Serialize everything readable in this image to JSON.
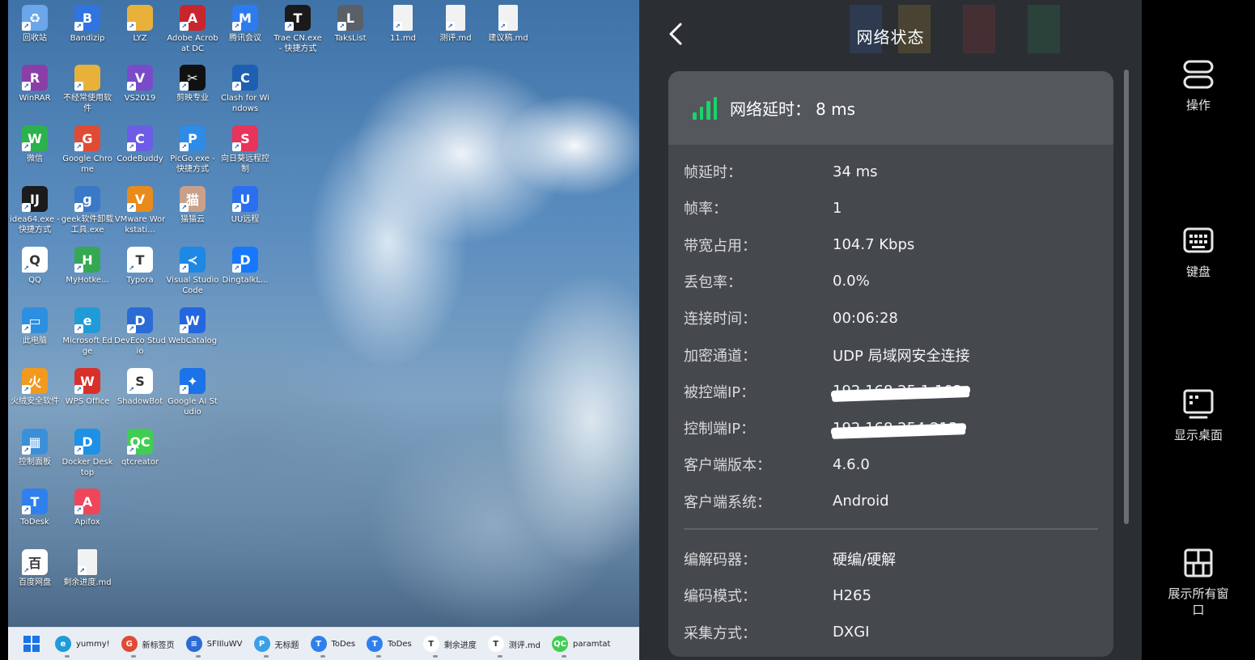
{
  "desktop": {
    "icons": [
      {
        "label": "回收站",
        "icon": "recycle-bin-icon",
        "color": "#6aa6e8",
        "glyph": "♻"
      },
      {
        "label": "Bandizip",
        "icon": "bandizip-icon",
        "color": "#2f74e0",
        "glyph": "B"
      },
      {
        "label": "LYZ",
        "icon": "folder-icon",
        "color": "#e8b23a",
        "glyph": ""
      },
      {
        "label": "Adobe Acrobat DC",
        "icon": "acrobat-icon",
        "color": "#c8262c",
        "glyph": "A"
      },
      {
        "label": "腾讯会议",
        "icon": "tencent-meeting-icon",
        "color": "#2d7bf0",
        "glyph": "M"
      },
      {
        "label": "Trae CN.exe - 快捷方式",
        "icon": "trae-icon",
        "color": "#1a1a1a",
        "glyph": "T"
      },
      {
        "label": "TaksList",
        "icon": "tasklist-icon",
        "color": "#5a6068",
        "glyph": "L"
      },
      {
        "label": "11.md",
        "icon": "md-file-icon",
        "color": "#f2f2f2",
        "glyph": ""
      },
      {
        "label": "测评.md",
        "icon": "md-file-icon",
        "color": "#f2f2f2",
        "glyph": ""
      },
      {
        "label": "建议稿.md",
        "icon": "md-file-icon",
        "color": "#f2f2f2",
        "glyph": ""
      },
      {
        "label": "WinRAR",
        "icon": "winrar-icon",
        "color": "#8a3ea8",
        "glyph": "R"
      },
      {
        "label": "不经常使用软件",
        "icon": "folder-icon",
        "color": "#e8b23a",
        "glyph": ""
      },
      {
        "label": "VS2019",
        "icon": "visual-studio-icon",
        "color": "#7a4bc8",
        "glyph": "V"
      },
      {
        "label": "剪映专业",
        "icon": "capcut-icon",
        "color": "#111111",
        "glyph": "✂"
      },
      {
        "label": "Clash for Windows",
        "icon": "clash-icon",
        "color": "#1d5fb0",
        "glyph": "C"
      },
      {
        "label": "微信",
        "icon": "wechat-icon",
        "color": "#2bb24c",
        "glyph": "W"
      },
      {
        "label": "Google Chrome",
        "icon": "chrome-icon",
        "color": "#e04b35",
        "glyph": "G"
      },
      {
        "label": "CodeBuddy",
        "icon": "codebuddy-icon",
        "color": "#6c5ce7",
        "glyph": "C"
      },
      {
        "label": "PicGo.exe - 快捷方式",
        "icon": "picgo-icon",
        "color": "#2e8be6",
        "glyph": "P"
      },
      {
        "label": "向日葵远程控制",
        "icon": "sunlogin-icon",
        "color": "#e8335a",
        "glyph": "S"
      },
      {
        "label": "idea64.exe - 快捷方式",
        "icon": "intellij-icon",
        "color": "#1b1b1b",
        "glyph": "IJ"
      },
      {
        "label": "geek软件卸载工具.exe",
        "icon": "geek-uninstaller-icon",
        "color": "#3a78c8",
        "glyph": "g"
      },
      {
        "label": "VMware Workstati...",
        "icon": "vmware-icon",
        "color": "#e98b1c",
        "glyph": "V"
      },
      {
        "label": "猫猫云",
        "icon": "cat-cloud-icon",
        "color": "#c9a08a",
        "glyph": "猫"
      },
      {
        "label": "UU远程",
        "icon": "uu-remote-icon",
        "color": "#2a6ff0",
        "glyph": "U"
      },
      {
        "label": "QQ",
        "icon": "qq-icon",
        "color": "#ffffff",
        "glyph": "Q"
      },
      {
        "label": "MyHotke...",
        "icon": "myhotkey-icon",
        "color": "#35a853",
        "glyph": "H"
      },
      {
        "label": "Typora",
        "icon": "typora-icon",
        "color": "#ffffff",
        "glyph": "T"
      },
      {
        "label": "Visual Studio Code",
        "icon": "vscode-icon",
        "color": "#1e88e5",
        "glyph": "≺"
      },
      {
        "label": "DingtalkL...",
        "icon": "dingtalk-icon",
        "color": "#1677ff",
        "glyph": "D"
      },
      {
        "label": "此电脑",
        "icon": "this-pc-icon",
        "color": "#2d8fe0",
        "glyph": "▭"
      },
      {
        "label": "Microsoft Edge",
        "icon": "edge-icon",
        "color": "#1f9cd8",
        "glyph": "e"
      },
      {
        "label": "DevEco Studio",
        "icon": "deveco-icon",
        "color": "#2b6bd6",
        "glyph": "D"
      },
      {
        "label": "WebCatalog",
        "icon": "webcatalog-icon",
        "color": "#2466e0",
        "glyph": "W"
      },
      {
        "label": "火绒安全软件",
        "icon": "huorong-icon",
        "color": "#f29a1f",
        "glyph": "火"
      },
      {
        "label": "WPS Office",
        "icon": "wps-icon",
        "color": "#d9302a",
        "glyph": "W"
      },
      {
        "label": "ShadowBot",
        "icon": "shadowbot-icon",
        "color": "#ffffff",
        "glyph": "S"
      },
      {
        "label": "Google AI Studio",
        "icon": "google-ai-studio-icon",
        "color": "#1a73e8",
        "glyph": "✦"
      },
      {
        "label": "控制面板",
        "icon": "control-panel-icon",
        "color": "#3b8fd9",
        "glyph": "▦"
      },
      {
        "label": "Docker Desktop",
        "icon": "docker-icon",
        "color": "#1d91e6",
        "glyph": "D"
      },
      {
        "label": "qtcreator",
        "icon": "qtcreator-icon",
        "color": "#41cd52",
        "glyph": "QC"
      },
      {
        "label": "ToDesk",
        "icon": "todesk-icon",
        "color": "#2f80ed",
        "glyph": "T"
      },
      {
        "label": "Apifox",
        "icon": "apifox-icon",
        "color": "#f0465a",
        "glyph": "A"
      },
      {
        "label": "百度网盘",
        "icon": "baidu-netdisk-icon",
        "color": "#ffffff",
        "glyph": "百"
      },
      {
        "label": "剩余进度.md",
        "icon": "md-file-icon",
        "color": "#f2f2f2",
        "glyph": ""
      }
    ]
  },
  "taskbar": {
    "items": [
      {
        "label": "yummy!",
        "icon": "edge-icon",
        "color": "#1f9cd8",
        "glyph": "e"
      },
      {
        "label": "新标签页",
        "icon": "chrome-icon",
        "color": "#e04b35",
        "glyph": "G"
      },
      {
        "label": "SFIIluWV",
        "icon": "notepad-icon",
        "color": "#2b6bd6",
        "glyph": "≡"
      },
      {
        "label": "无标题",
        "icon": "paint-icon",
        "color": "#3aa0e8",
        "glyph": "P"
      },
      {
        "label": "ToDes",
        "icon": "todesk-icon",
        "color": "#2f80ed",
        "glyph": "T"
      },
      {
        "label": "ToDes",
        "icon": "todesk-icon",
        "color": "#2f80ed",
        "glyph": "T"
      },
      {
        "label": "剩余进度",
        "icon": "typora-icon",
        "color": "#ffffff",
        "glyph": "T"
      },
      {
        "label": "测评.md",
        "icon": "typora-icon",
        "color": "#ffffff",
        "glyph": "T"
      },
      {
        "label": "paramtat",
        "icon": "qtcreator-icon",
        "color": "#41cd52",
        "glyph": "QC"
      }
    ]
  },
  "panel": {
    "title": "网络状态",
    "latency_label": "网络延时：",
    "latency_value": "8 ms",
    "accent": "#19d36b",
    "rows": [
      {
        "key": "帧延时：",
        "value": "34 ms"
      },
      {
        "key": "帧率：",
        "value": "1"
      },
      {
        "key": "带宽占用：",
        "value": "104.7 Kbps"
      },
      {
        "key": "丢包率：",
        "value": "0.0%"
      },
      {
        "key": "连接时间：",
        "value": "00:06:28"
      },
      {
        "key": "加密通道：",
        "value": "UDP 局域网安全连接"
      },
      {
        "key": "被控端IP：",
        "value": "192.168.25.1.102"
      },
      {
        "key": "控制端IP：",
        "value": "192.168.254.213"
      },
      {
        "key": "客户端版本：",
        "value": "4.6.0"
      },
      {
        "key": "客户端系统：",
        "value": "Android"
      }
    ],
    "rows2": [
      {
        "key": "编解码器：",
        "value": "硬编/硬解"
      },
      {
        "key": "编码模式：",
        "value": "H265"
      },
      {
        "key": "采集方式：",
        "value": "DXGI"
      }
    ]
  },
  "sidebar": {
    "operate_label": "操作",
    "keyboard_label": "键盘",
    "show_desktop_label": "显示桌面",
    "show_windows_label": "展示所有窗口"
  }
}
